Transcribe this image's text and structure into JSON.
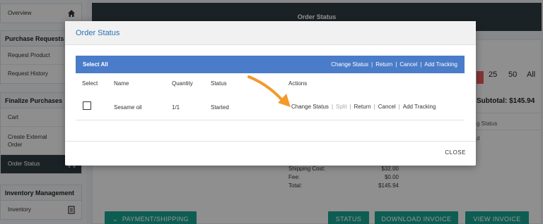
{
  "sidebar": {
    "overview": "Overview",
    "purchase_requests": {
      "title": "Purchase Requests",
      "items": [
        "Request Product",
        "Request History"
      ]
    },
    "finalize_purchases": {
      "title": "Finalize Purchases",
      "items": [
        "Cart",
        "Create External Order",
        "Order Status"
      ]
    },
    "inventory_management": {
      "title": "Inventory Management",
      "items": [
        "Inventory"
      ]
    }
  },
  "page": {
    "title": "Order Status",
    "pager": [
      "25",
      "50",
      "All"
    ],
    "subtotal": "Subtotal: $145.94",
    "partial_col_1": "g Status",
    "partial_col_2": "d",
    "totals": [
      {
        "label": "Shipping Cost:",
        "value": "$32.00"
      },
      {
        "label": "Fee:",
        "value": "$0.00"
      },
      {
        "label": "Total:",
        "value": "$145.94"
      }
    ],
    "buttons": {
      "payment_shipping": "PAYMENT/SHIPPING",
      "status": "STATUS",
      "download_invoice": "DOWNLOAD INVOICE",
      "view_invoice": "VIEW INVOICE"
    }
  },
  "modal": {
    "title": "Order Status",
    "toolbar": {
      "select_all": "Select All",
      "change_status": "Change Status",
      "return": "Return",
      "cancel": "Cancel",
      "add_tracking": "Add Tracking",
      "separator": "|"
    },
    "columns": [
      "Select",
      "Name",
      "Quantity",
      "Status",
      "Actions"
    ],
    "rows": [
      {
        "name": "Sesame oil",
        "quantity": "1/1",
        "status": "Started",
        "actions": {
          "change_status": "Change Status",
          "split": "Split",
          "return": "Return",
          "cancel": "Cancel",
          "add_tracking": "Add Tracking"
        }
      }
    ],
    "close": "CLOSE"
  },
  "colors": {
    "accent_blue": "#4a7cc9",
    "teal_button": "#19a18f",
    "dark_header": "#2f3b43",
    "arrow": "#f39a2b"
  }
}
